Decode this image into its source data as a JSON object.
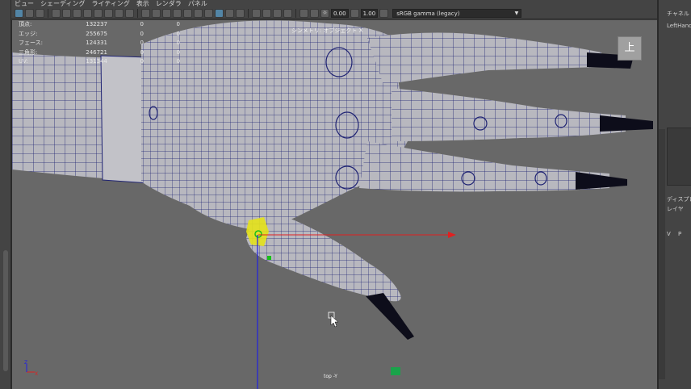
{
  "menu": [
    "ビュー",
    "シェーディング",
    "ライティング",
    "表示",
    "レンダラ",
    "パネル"
  ],
  "toolbar": {
    "exposure": "0.00",
    "gamma": "1.00",
    "color_space": "sRGB gamma (legacy)"
  },
  "hud": {
    "rows": [
      {
        "label": "頂点:",
        "value": "132237",
        "sel": "0",
        "extra": "0"
      },
      {
        "label": "エッジ:",
        "value": "255675",
        "sel": "0",
        "extra": "0"
      },
      {
        "label": "フェース:",
        "value": "124331",
        "sel": "0",
        "extra": "0"
      },
      {
        "label": "三角形:",
        "value": "246721",
        "sel": "0",
        "extra": "0"
      },
      {
        "label": "UV:",
        "value": "131344",
        "sel": "0",
        "extra": "0"
      }
    ]
  },
  "viewport": {
    "object_label": "シンメトリ: オブジェクト X",
    "camera_label": "top -Y",
    "view_cube_label": "上"
  },
  "right_panel": {
    "channel_title": "チャネル",
    "object_name": "LeftHand",
    "display_title": "ディスプレ",
    "layer_title": "レイヤ",
    "col_v": "V",
    "col_p": "P"
  },
  "colors": {
    "viewport_bg": "#686868",
    "mesh_fill": "#b8b8bf",
    "wire": "#1e2273",
    "nail": "#0d0d1a",
    "accent": "#5285a6",
    "x_axis": "#e02020",
    "y_axis": "#18c018",
    "z_axis": "#2020e0",
    "selection": "#e4e21a"
  }
}
